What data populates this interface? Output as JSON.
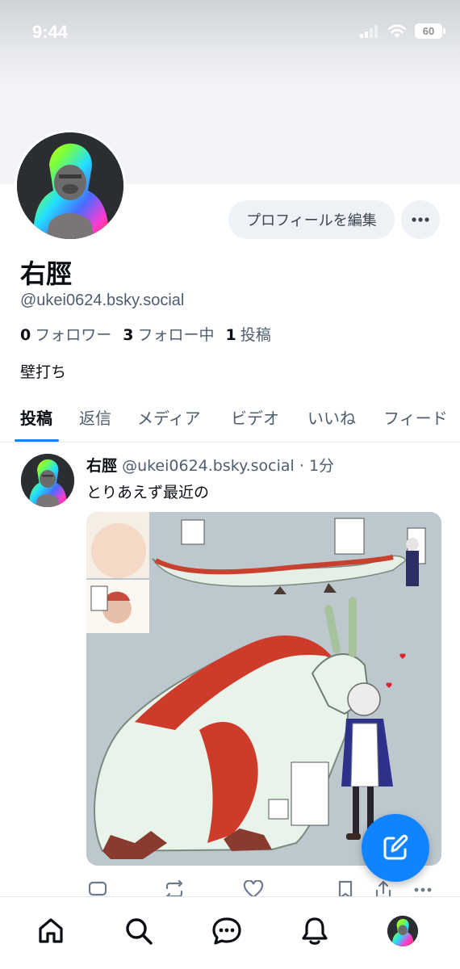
{
  "status_bar": {
    "time": "9:44",
    "battery": "60"
  },
  "profile": {
    "display_name": "右脛",
    "handle": "@ukei0624.bsky.social",
    "edit_label": "プロフィールを編集",
    "followers_count": "0",
    "followers_label": "フォロワー",
    "following_count": "3",
    "following_label": "フォロー中",
    "posts_count": "1",
    "posts_label": "投稿",
    "bio": "壁打ち"
  },
  "tabs": [
    {
      "label": "投稿",
      "active": true
    },
    {
      "label": "返信"
    },
    {
      "label": "メディア"
    },
    {
      "label": "ビデオ"
    },
    {
      "label": "いいね"
    },
    {
      "label": "フィード"
    }
  ],
  "post": {
    "author": "右脛",
    "handle": "@ukei0624.bsky.social",
    "time": "· 1分",
    "text": "とりあえず最近の"
  },
  "colors": {
    "accent": "#1083fe",
    "muted": "#4e5d70",
    "surface": "#eef1f5"
  },
  "icons": [
    "signal-icon",
    "wifi-icon",
    "battery-icon",
    "more-icon",
    "reply-icon",
    "repost-icon",
    "like-icon",
    "bookmark-icon",
    "share-icon",
    "compose-icon",
    "home-icon",
    "search-icon",
    "chat-icon",
    "bell-icon"
  ]
}
